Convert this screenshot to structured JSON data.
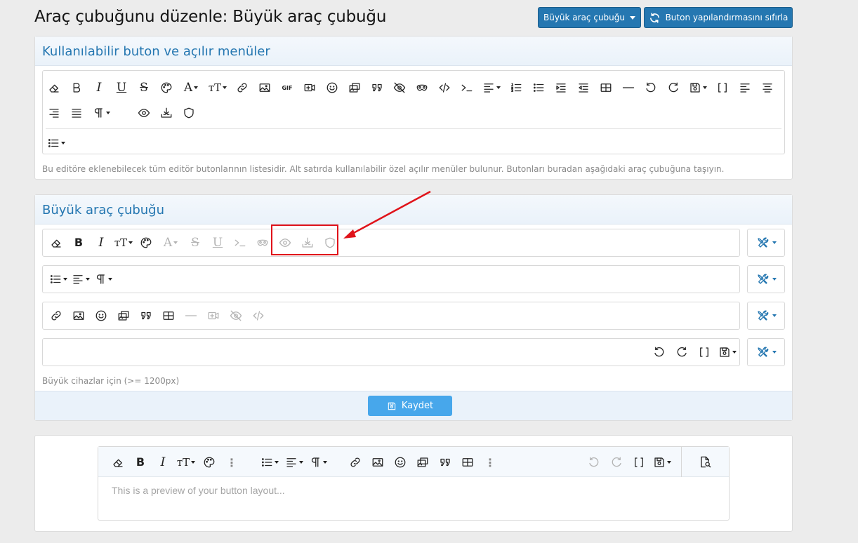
{
  "header": {
    "title": "Araç çubuğunu düzenle: Büyük araç çubuğu",
    "dropdown_label": "Büyük araç çubuğu",
    "reset_label": "Buton yapılandırmasını sıfırla"
  },
  "available": {
    "title": "Kullanılabilir buton ve açılır menüler",
    "help": "Bu editöre eklenebilecek tüm editör butonlarının listesidir. Alt satırda kullanılabilir özel açılır menüler bulunur. Butonları buradan aşağıdaki araç çubuğuna taşıyın.",
    "gif_label": "GIF"
  },
  "toolbar": {
    "title": "Büyük araç çubuğu",
    "help": "Büyük cihazlar için (>= 1200px)",
    "save_label": "Kaydet"
  },
  "preview": {
    "placeholder": "This is a preview of your button layout..."
  },
  "colors": {
    "accent": "#2577b1",
    "highlight": "#e0131a",
    "save_button": "#47a7eb"
  }
}
